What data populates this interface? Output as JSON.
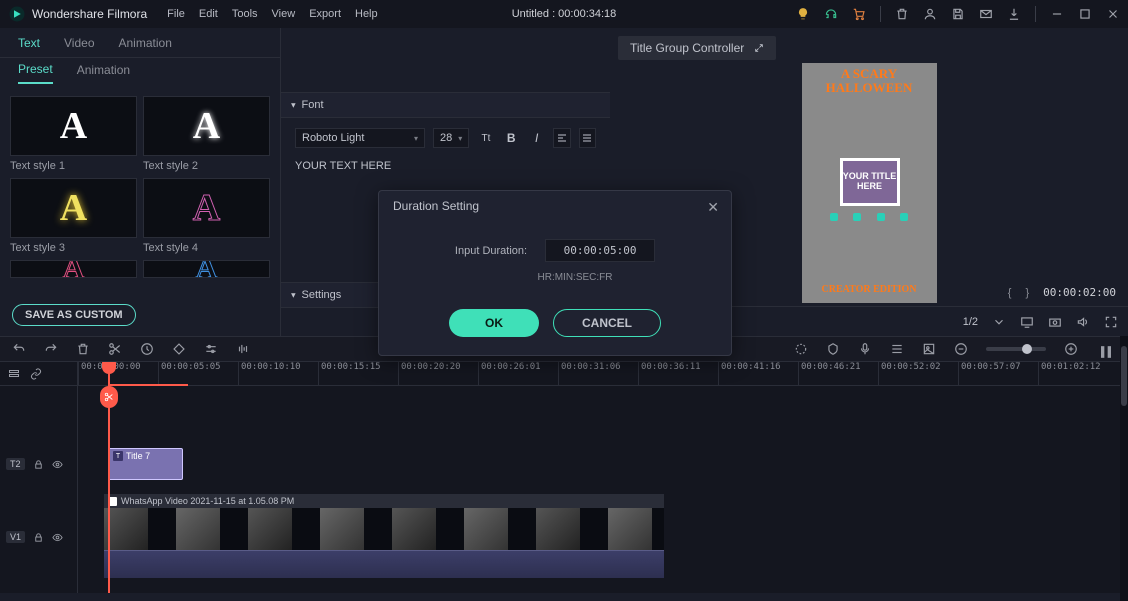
{
  "app": {
    "title": "Wondershare Filmora",
    "document": "Untitled : 00:00:34:18"
  },
  "menubar": [
    "File",
    "Edit",
    "Tools",
    "View",
    "Export",
    "Help"
  ],
  "left": {
    "tabs": [
      "Text",
      "Video",
      "Animation"
    ],
    "subtabs": [
      "Preset",
      "Animation"
    ],
    "presets": [
      {
        "label": "Text style 1"
      },
      {
        "label": "Text style 2"
      },
      {
        "label": "Text style 3"
      },
      {
        "label": "Text style 4"
      }
    ],
    "save_custom": "SAVE AS CUSTOM"
  },
  "font_panel": {
    "section_font": "Font",
    "family": "Roboto Light",
    "size": "28",
    "sample": "YOUR TEXT HERE",
    "section_settings": "Settings"
  },
  "preview": {
    "title_group_btn": "Title Group Controller",
    "top_line": "A SCARY HALLOWEEN",
    "box_text": "YOUR TITLE HERE",
    "bottom_line": "CREATOR EDITION",
    "page_fraction": "1/2",
    "timecode": "00:00:02:00"
  },
  "modal": {
    "title": "Duration Setting",
    "label": "Input Duration:",
    "value": "00:00:05:00",
    "hint": "HR:MIN:SEC:FR",
    "ok": "OK",
    "cancel": "CANCEL"
  },
  "ruler": [
    "00:00:00:00",
    "00:00:05:05",
    "00:00:10:10",
    "00:00:15:15",
    "00:00:20:20",
    "00:00:26:01",
    "00:00:31:06",
    "00:00:36:11",
    "00:00:41:16",
    "00:00:46:21",
    "00:00:52:02",
    "00:00:57:07",
    "00:01:02:12"
  ],
  "tracks": {
    "t2_badge": "T2",
    "v1_badge": "V1",
    "title_clip": "Title 7",
    "video_clip_name": "WhatsApp Video 2021-11-15 at 1.05.08 PM"
  }
}
